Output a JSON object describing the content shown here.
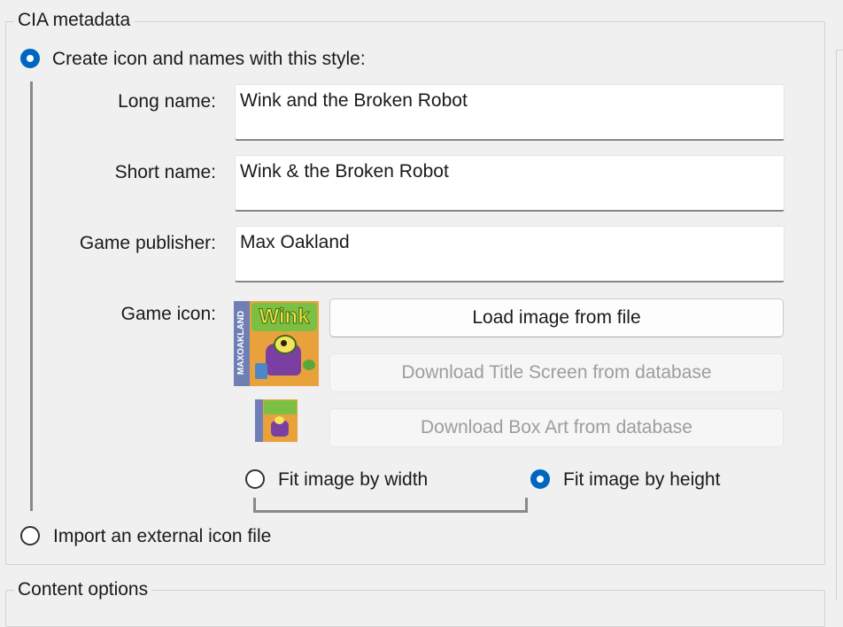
{
  "cia_group": {
    "title": "CIA metadata",
    "style_radio_label": "Create icon and names with this style:",
    "import_radio_label": "Import an external icon file",
    "long_name_label": "Long name:",
    "long_name_value": "Wink and the Broken Robot",
    "short_name_label": "Short name:",
    "short_name_value": "Wink & the Broken Robot",
    "publisher_label": "Game publisher:",
    "publisher_value": "Max Oakland",
    "game_icon_label": "Game icon:",
    "load_button": "Load image from file",
    "download_title_button": "Download Title Screen from database",
    "download_box_button": "Download Box Art from database",
    "fit_width_label": "Fit image by width",
    "fit_height_label": "Fit image by height",
    "selected_mode": "style",
    "selected_fit": "height",
    "icon_logo_text": "Wink",
    "icon_side_text": "MAXOAKLAND"
  },
  "content_group": {
    "title": "Content options"
  },
  "colors": {
    "accent": "#0067c0",
    "icon_orange": "#e9a23b",
    "icon_green": "#7bc043",
    "icon_purple": "#7a3fa0",
    "icon_blue_strip": "#6f7fb5"
  }
}
